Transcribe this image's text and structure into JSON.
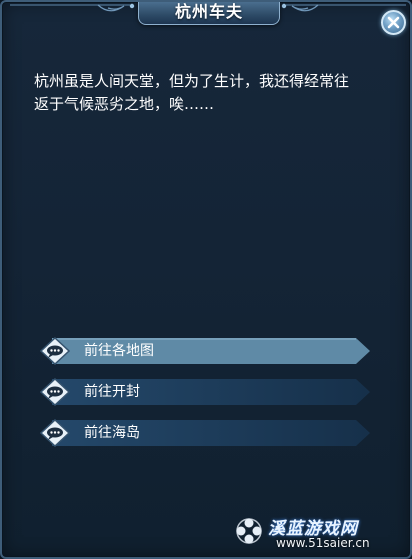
{
  "dialog": {
    "title": "杭州车夫",
    "close_icon": "close-icon",
    "narrative": [
      "杭州虽是人间天堂，但为了生计，我还得经常往",
      "返于气候恶劣之地，唉……"
    ]
  },
  "options": [
    {
      "label": "前往各地图",
      "icon": "speech-bubble-icon",
      "highlighted": true
    },
    {
      "label": "前往开封",
      "icon": "speech-bubble-icon",
      "highlighted": false
    },
    {
      "label": "前往海岛",
      "icon": "speech-bubble-icon",
      "highlighted": false
    }
  ],
  "watermark": {
    "brand": "溪蓝游戏网",
    "url": "www.51saier.cn"
  },
  "colors": {
    "panel_bg": "#142436",
    "panel_border": "#3e5d79",
    "option_highlight": "#5f8aa6",
    "option_normal": "#1c3a55",
    "text": "#ffffff"
  }
}
